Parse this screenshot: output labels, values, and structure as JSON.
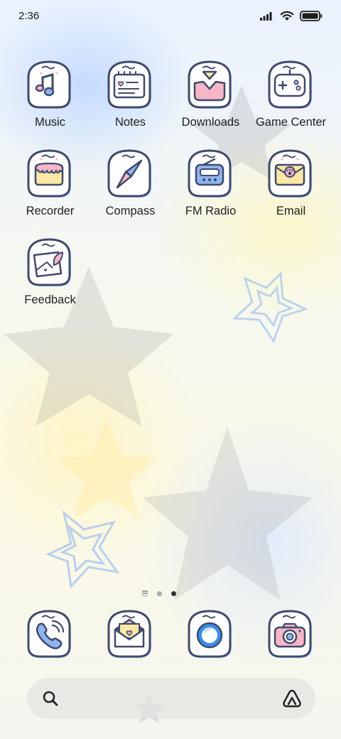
{
  "status_bar": {
    "time": "2:36",
    "icons": [
      "signal-icon",
      "wifi-icon",
      "battery-icon"
    ]
  },
  "apps": [
    {
      "label": "Music",
      "icon": "music-note-icon"
    },
    {
      "label": "Notes",
      "icon": "notepad-icon"
    },
    {
      "label": "Downloads",
      "icon": "download-tray-icon"
    },
    {
      "label": "Game Center",
      "icon": "gamepad-icon"
    },
    {
      "label": "Recorder",
      "icon": "cake-recorder-icon"
    },
    {
      "label": "Compass",
      "icon": "compass-needle-icon"
    },
    {
      "label": "FM Radio",
      "icon": "radio-icon"
    },
    {
      "label": "Email",
      "icon": "envelope-paw-icon"
    },
    {
      "label": "Feedback",
      "icon": "feedback-letter-icon"
    }
  ],
  "page_indicator": {
    "pages": 2,
    "active_page": 2
  },
  "dock": [
    {
      "name": "phone",
      "icon": "phone-icon"
    },
    {
      "name": "messages",
      "icon": "envelope-heart-icon"
    },
    {
      "name": "browser",
      "icon": "browser-orb-icon"
    },
    {
      "name": "camera",
      "icon": "camera-icon"
    }
  ],
  "search": {
    "icon": "search-icon",
    "assistant_icon": "assistant-triangle-icon"
  },
  "colors": {
    "icon_outline": "#3f4a6b",
    "icon_fill": "#ffffff",
    "icon_shadow": "#c4d6ff",
    "accent_pink": "#f6b6c8",
    "accent_blue": "#8fb5f0",
    "accent_yellow": "#fbe7a6"
  }
}
